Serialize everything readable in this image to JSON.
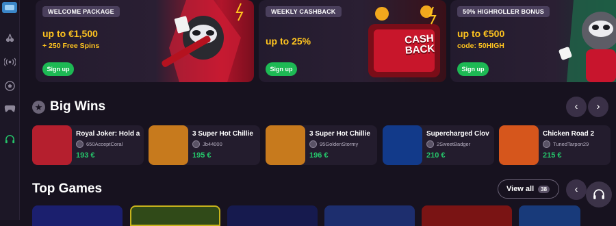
{
  "sidebar": {
    "items": [
      {
        "icon": "cherries-icon"
      },
      {
        "icon": "live-broadcast-icon"
      },
      {
        "icon": "soccer-ball-icon"
      },
      {
        "icon": "gamepad-icon"
      },
      {
        "icon": "headset-support-icon"
      }
    ]
  },
  "banners": [
    {
      "tag": "WELCOME PACKAGE",
      "headline": "up to €1,500",
      "sub": "+ 250 Free Spins",
      "button": "Sign up"
    },
    {
      "tag": "WEEKLY CASHBACK",
      "headline": "up to 25%",
      "sub": "",
      "button": "Sign up",
      "art_text": "CASH BACK"
    },
    {
      "tag": "50% HIGHROLLER BONUS",
      "headline": "up to €500",
      "sub": "code: 50HIGH",
      "button": "Sign up"
    }
  ],
  "big_wins": {
    "title": "Big Wins",
    "cards": [
      {
        "game": "Royal Joker: Hold a",
        "user": "650AcceptCoral",
        "amount": "193 €",
        "thumb_color": "#b51f2e"
      },
      {
        "game": "3 Super Hot Chillie",
        "user": "Jb44000",
        "amount": "195 €",
        "thumb_color": "#c77a1d"
      },
      {
        "game": "3 Super Hot Chillie",
        "user": "95GoldenStormy",
        "amount": "196 €",
        "thumb_color": "#c77a1d"
      },
      {
        "game": "Supercharged Clov",
        "user": "2SweetBadger",
        "amount": "210 €",
        "thumb_color": "#123a8a"
      },
      {
        "game": "Chicken Road 2",
        "user": "TunedTarpon29",
        "amount": "215 €",
        "thumb_color": "#d6561c"
      }
    ]
  },
  "top_games": {
    "title": "Top Games",
    "view_all": "View all",
    "count": "38",
    "tiles": [
      "#1b1f6e",
      "#304a18",
      "#161a4e",
      "#1d2e6e",
      "#7a1414",
      "#183a7a"
    ]
  },
  "colors": {
    "accent": "#1db954",
    "win_green": "#25c46a",
    "gold": "#ffc41f"
  }
}
